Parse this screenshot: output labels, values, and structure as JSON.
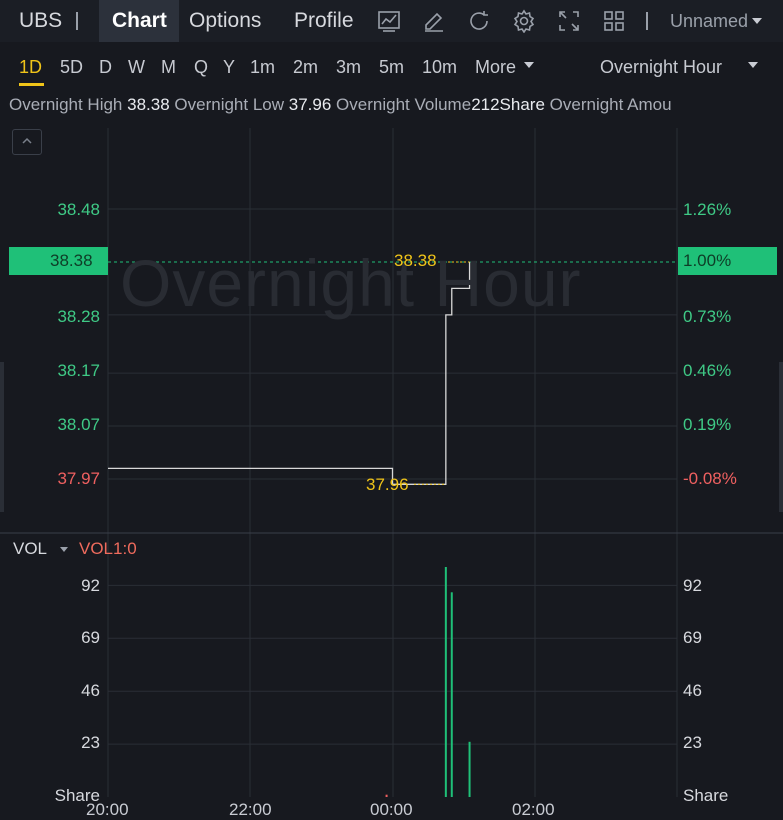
{
  "header": {
    "symbol": "UBS",
    "tabs": [
      "Chart",
      "Options",
      "Profile"
    ],
    "active_tab": "Chart",
    "layout_name": "Unnamed",
    "icons": [
      "indicator-icon",
      "draw-icon",
      "refresh-icon",
      "settings-icon",
      "fullscreen-icon",
      "layout-grid-icon"
    ]
  },
  "timeframes": {
    "items": [
      "1D",
      "5D",
      "D",
      "W",
      "M",
      "Q",
      "Y",
      "1m",
      "2m",
      "3m",
      "5m",
      "10m"
    ],
    "more_label": "More",
    "active": "1D",
    "session_label": "Overnight Hour"
  },
  "info": {
    "high_label": "Overnight High",
    "high_value": "38.38",
    "low_label": "Overnight Low",
    "low_value": "37.96",
    "volume_label": "Overnight Volume",
    "volume_value": "212Share",
    "amount_label": "Overnight Amou"
  },
  "price_chart": {
    "watermark": "Overnight Hour",
    "current_price": "38.38",
    "current_pct": "1.00%",
    "left_axis": [
      "38.48",
      "38.28",
      "38.17",
      "38.07",
      "37.97"
    ],
    "right_axis": [
      "1.26%",
      "0.73%",
      "0.46%",
      "0.19%",
      "-0.08%"
    ],
    "high_marker": "38.38",
    "low_marker": "37.96",
    "colors": {
      "up": "#1fc078",
      "down": "#ef5f5f",
      "marker": "#f0c419",
      "line": "#d8d8d8"
    }
  },
  "volume_panel": {
    "label": "VOL",
    "indicator": "VOL1:0",
    "left_axis": [
      "92",
      "69",
      "46",
      "23",
      "Share"
    ],
    "right_axis": [
      "92",
      "69",
      "46",
      "23",
      "Share"
    ]
  },
  "x_axis": [
    "20:00",
    "22:00",
    "00:00",
    "02:00"
  ],
  "chart_data": [
    {
      "type": "line",
      "title": "",
      "x": [
        "20:00",
        "20:30",
        "21:00",
        "21:30",
        "22:00",
        "22:30",
        "23:00",
        "23:30",
        "23:55",
        "00:00",
        "00:20",
        "00:40",
        "00:45",
        "00:50",
        "00:55",
        "01:00",
        "01:05"
      ],
      "series": [
        {
          "values": [
            37.99,
            37.99,
            37.99,
            37.99,
            37.99,
            37.99,
            37.99,
            37.99,
            37.99,
            37.96,
            37.96,
            37.96,
            38.28,
            38.33,
            38.33,
            38.33,
            38.38
          ]
        }
      ],
      "ylim": [
        37.92,
        38.6
      ],
      "grid": true
    },
    {
      "type": "bar",
      "title": "",
      "x": [
        "23:55",
        "00:45",
        "00:50",
        "01:05"
      ],
      "values": [
        1,
        100,
        89,
        24
      ],
      "ylim": [
        0,
        115
      ],
      "grid": true
    }
  ]
}
